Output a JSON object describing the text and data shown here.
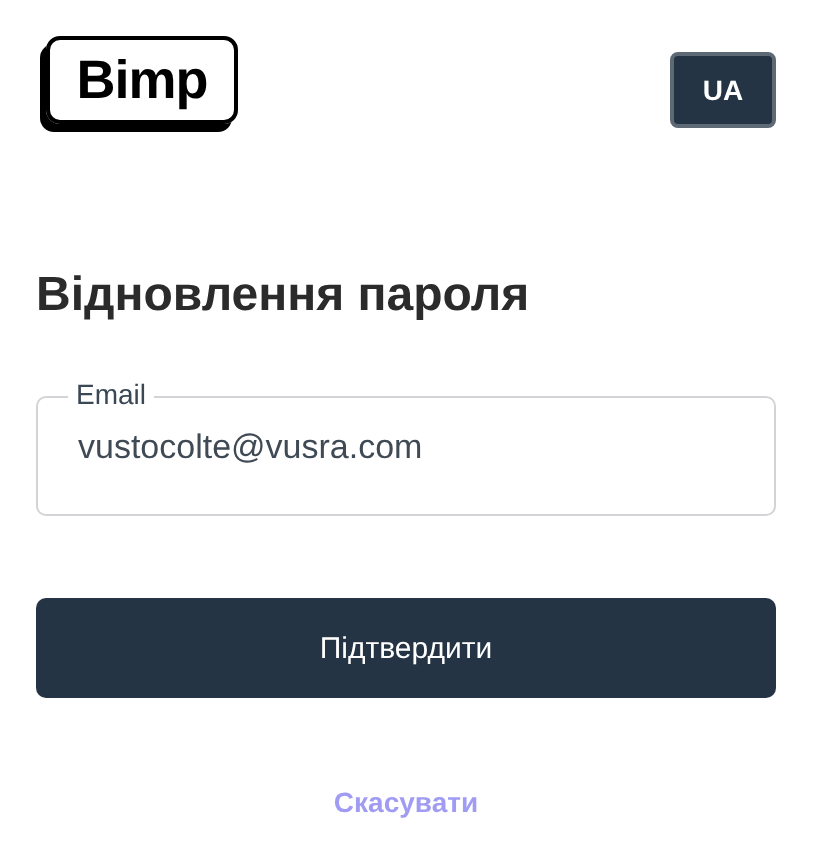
{
  "logo": "Bimp",
  "language_button": "UA",
  "title": "Відновлення пароля",
  "email_field": {
    "label": "Email",
    "value": "vustocolte@vusra.com"
  },
  "submit_button": "Підтвердити",
  "cancel_link": "Скасувати"
}
